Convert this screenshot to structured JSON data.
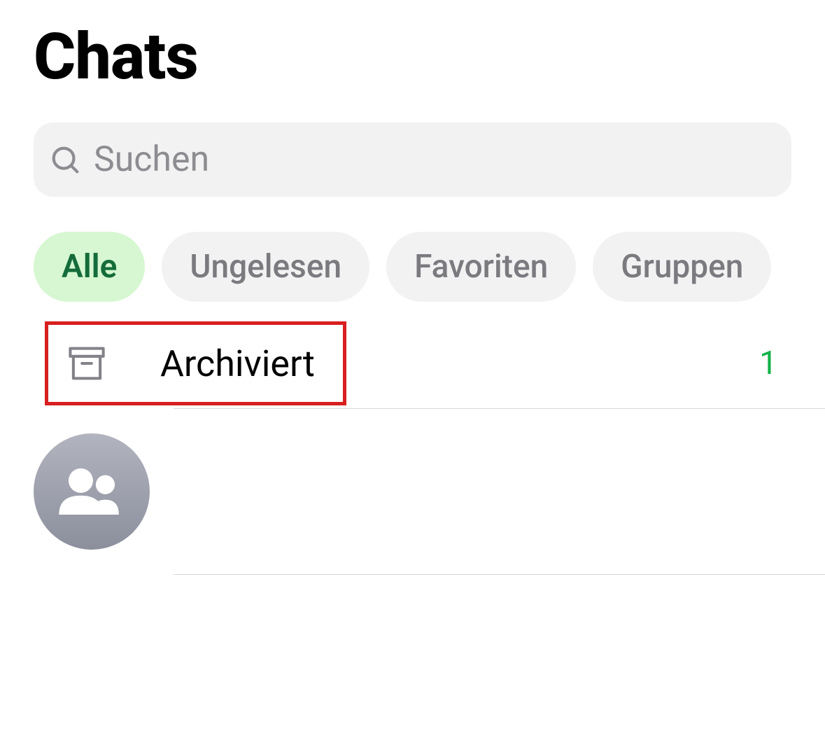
{
  "header": {
    "title": "Chats"
  },
  "search": {
    "placeholder": "Suchen"
  },
  "filters": [
    {
      "label": "Alle",
      "active": true
    },
    {
      "label": "Ungelesen",
      "active": false
    },
    {
      "label": "Favoriten",
      "active": false
    },
    {
      "label": "Gruppen",
      "active": false
    }
  ],
  "archived": {
    "label": "Archiviert",
    "count": "1"
  },
  "colors": {
    "accent_green": "#13b34a",
    "active_chip_bg": "#d6f7d1",
    "active_chip_text": "#146c3a",
    "highlight_border": "#d81f1f"
  }
}
